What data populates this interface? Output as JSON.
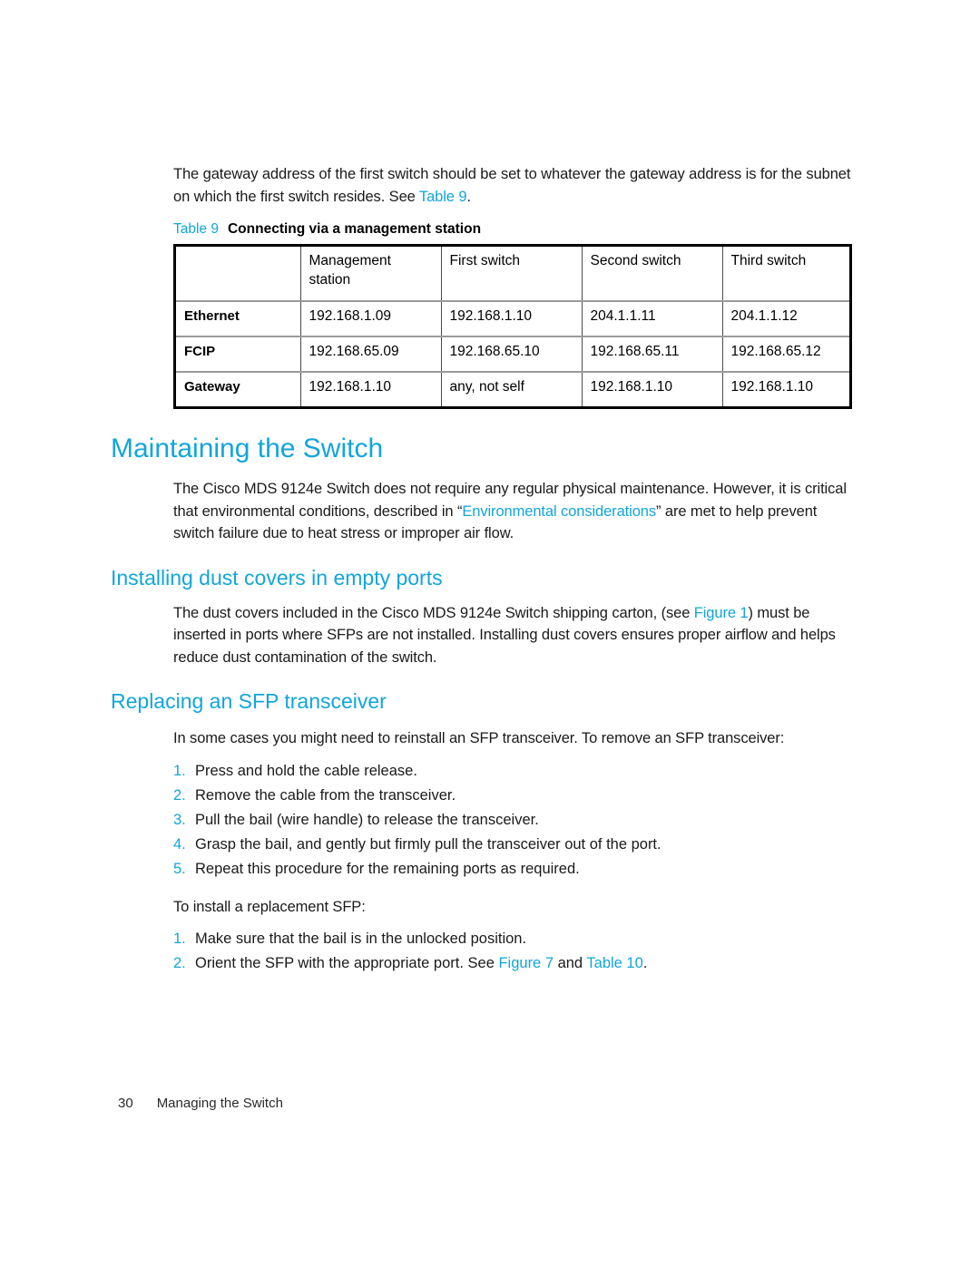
{
  "document": {
    "intro_paragraph_pre": "The gateway address of the first switch should be set to whatever the gateway address is for the subnet on which the first switch resides. See ",
    "intro_paragraph_link": "Table 9",
    "intro_paragraph_post": "."
  },
  "table_caption": {
    "label": "Table 9",
    "title": "Connecting via a management station"
  },
  "table": {
    "headers": [
      "",
      "Management station",
      "First switch",
      "Second switch",
      "Third switch"
    ],
    "rows": [
      {
        "label": "Ethernet",
        "cells": [
          "192.168.1.09",
          "192.168.1.10",
          "204.1.1.11",
          "204.1.1.12"
        ]
      },
      {
        "label": "FCIP",
        "cells": [
          "192.168.65.09",
          "192.168.65.10",
          "192.168.65.11",
          "192.168.65.12"
        ]
      },
      {
        "label": "Gateway",
        "cells": [
          "192.168.1.10",
          "any, not self",
          "192.168.1.10",
          "192.168.1.10"
        ]
      }
    ]
  },
  "maintaining": {
    "heading": "Maintaining the Switch",
    "paragraph_pre": "The Cisco MDS 9124e Switch does not require any regular physical maintenance. However, it is critical that environmental conditions, described in “",
    "paragraph_link": "Environmental considerations",
    "paragraph_post": "” are met to help prevent switch failure due to heat stress or improper air flow."
  },
  "dust_covers": {
    "heading": "Installing dust covers in empty ports",
    "paragraph_pre": "The dust covers included in the Cisco MDS 9124e Switch shipping carton, (see ",
    "paragraph_link": "Figure 1",
    "paragraph_post": ") must be inserted in ports where SFPs are not installed. Installing dust covers ensures proper airflow and helps reduce dust contamination of the switch."
  },
  "sfp": {
    "heading": "Replacing an SFP transceiver",
    "lead": "In some cases you might need to reinstall an SFP transceiver. To remove an SFP transceiver:",
    "remove_steps": [
      {
        "num": "1.",
        "text": "Press and hold the cable release."
      },
      {
        "num": "2.",
        "text": "Remove the cable from the transceiver."
      },
      {
        "num": "3.",
        "text": "Pull the bail (wire handle) to release the transceiver."
      },
      {
        "num": "4.",
        "text": "Grasp the bail, and gently but firmly pull the transceiver out of the port."
      },
      {
        "num": "5.",
        "text": "Repeat this procedure for the remaining ports as required."
      }
    ],
    "install_lead": "To install a replacement SFP:",
    "install_steps": [
      {
        "num": "1.",
        "text": "Make sure that the bail is in the unlocked position."
      }
    ],
    "install_step2": {
      "num": "2.",
      "pre": "Orient the SFP with the appropriate port. See ",
      "link1": "Figure 7",
      "mid": " and ",
      "link2": "Table 10",
      "post": "."
    }
  },
  "footer": {
    "page_number": "30",
    "section": "Managing the Switch"
  },
  "colors": {
    "accent": "#12a5dc",
    "text": "#1a1a1a",
    "table_border": "#000000",
    "table_rule": "#9a9a9a"
  }
}
